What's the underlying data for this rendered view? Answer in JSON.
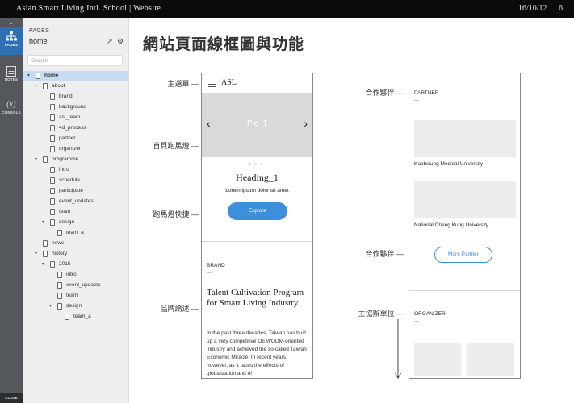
{
  "header": {
    "title": "Asian Smart Living Intl. School | Website",
    "date": "16/10/12",
    "page_number": "6"
  },
  "rail": {
    "items": [
      {
        "label": "PAGES",
        "icon": "sitemap-icon"
      },
      {
        "label": "NOTES",
        "icon": "notes-icon"
      },
      {
        "label": "CONSOLE",
        "icon": "variable-icon",
        "glyph": "(x)"
      }
    ],
    "close_label": "CLOSE"
  },
  "pages_panel": {
    "heading": "PAGES",
    "current": "home",
    "search_placeholder": "Search",
    "tree": [
      {
        "name": "home",
        "level": 0,
        "expanded": true,
        "selected": true
      },
      {
        "name": "about",
        "level": 1,
        "expanded": true
      },
      {
        "name": "brand",
        "level": 2
      },
      {
        "name": "background",
        "level": 2
      },
      {
        "name": "asl_team",
        "level": 2
      },
      {
        "name": "4d_process",
        "level": 2
      },
      {
        "name": "partner",
        "level": 2
      },
      {
        "name": "organizer",
        "level": 2
      },
      {
        "name": "programme",
        "level": 1,
        "expanded": true
      },
      {
        "name": "intro",
        "level": 2
      },
      {
        "name": "schedule",
        "level": 2
      },
      {
        "name": "participate",
        "level": 2
      },
      {
        "name": "event_updates",
        "level": 2
      },
      {
        "name": "team",
        "level": 2
      },
      {
        "name": "design",
        "level": 2,
        "expanded": true
      },
      {
        "name": "team_a",
        "level": 3
      },
      {
        "name": "news",
        "level": 1
      },
      {
        "name": "history",
        "level": 1,
        "expanded": true
      },
      {
        "name": "2015",
        "level": 2,
        "expanded": true
      },
      {
        "name": "intro",
        "level": 3
      },
      {
        "name": "event_updates",
        "level": 3
      },
      {
        "name": "team",
        "level": 3
      },
      {
        "name": "design",
        "level": 3,
        "expanded": true
      },
      {
        "name": "team_a",
        "level": 4
      }
    ]
  },
  "main": {
    "title": "網站頁面線框圖與功能",
    "annotations_left": [
      "主選單 —",
      "首頁跑馬燈 —",
      "跑馬燈快捷 —",
      "品牌論述 —"
    ],
    "annotations_right": [
      "合作夥伴 —",
      "合作夥伴 —",
      "主協辦單位 —"
    ],
    "left_phone": {
      "logo": "ASL",
      "carousel_label": "Pic_1",
      "heading": "Heading_1",
      "subtext": "Lorem ipsum dolor sit amet",
      "button": "Explore",
      "brand_label": "BRAND",
      "dash": "—",
      "brand_title": "Talent Cultivation Program for Smart Living Industry",
      "brand_paragraph": "In the past three decades, Taiwan has built up a very competitive OEM/ODM-oriented industry and achieved the so-called Taiwan Economic Miracle. In recent years, however, as it faces the effects of globalization and of"
    },
    "right_phone": {
      "partner_label": "PARTNER",
      "dash": "—",
      "partners": [
        "Kaohsiung Medical University",
        "National Cheng Kung University"
      ],
      "more_button": "More Partner",
      "organizer_label": "ORGANIZER"
    }
  }
}
